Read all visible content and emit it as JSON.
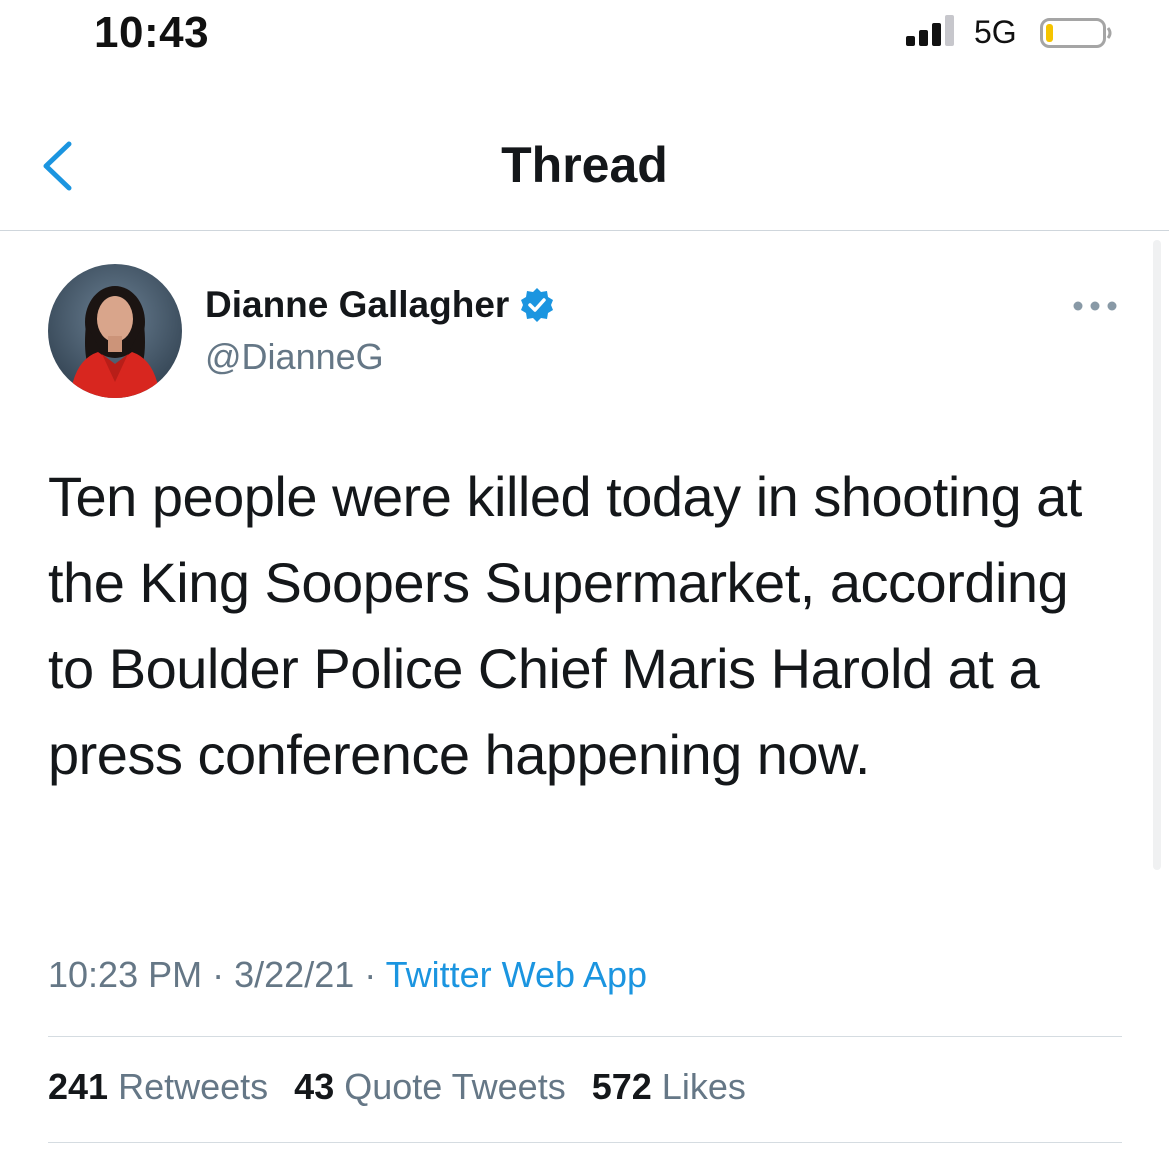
{
  "status_bar": {
    "time": "10:43",
    "network": "5G",
    "signal_icon": "cellular-signal-icon",
    "battery_icon": "battery-low-icon",
    "battery_level": 0.1,
    "battery_color": "#f5c400"
  },
  "header": {
    "title": "Thread",
    "back_icon": "chevron-left-icon",
    "accent": "#1b95e0"
  },
  "tweet": {
    "author_name": "Dianne Gallagher",
    "handle": "@DianneG",
    "verified": true,
    "verified_icon": "verified-badge-icon",
    "more_icon": "ellipsis-icon",
    "text": "Ten people were killed today in shooting at the King Soopers Supermarket, according to Boulder Police Chief Maris Harold at a press conference happening now.",
    "time": "10:23 PM",
    "separator": "·",
    "date": "3/22/21",
    "source": "Twitter Web App",
    "stats": {
      "retweets_count": "241",
      "retweets_label": "Retweets",
      "quotes_count": "43",
      "quotes_label": "Quote Tweets",
      "likes_count": "572",
      "likes_label": "Likes"
    }
  }
}
